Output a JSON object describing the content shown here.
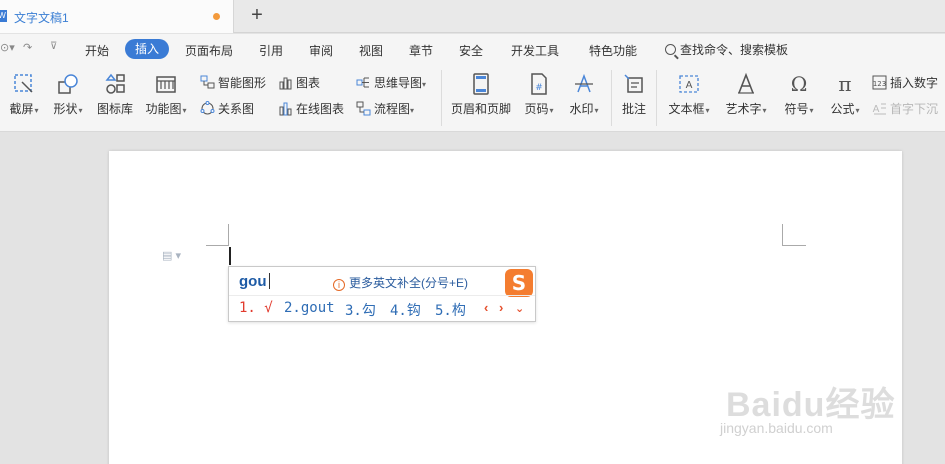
{
  "title_bar": {
    "tab_title": "文字文稿1",
    "new_tab": "+"
  },
  "menubar": {
    "items": [
      "开始",
      "插入",
      "页面布局",
      "引用",
      "审阅",
      "视图",
      "章节",
      "安全",
      "开发工具",
      "特色功能"
    ],
    "active": "插入",
    "search_label": "查找命令、搜索模板"
  },
  "ribbon": {
    "screenshot": "截屏",
    "shapes": "形状",
    "icon_library": "图标库",
    "function_chart": "功能图",
    "smart_art": "智能图形",
    "relation_chart": "关系图",
    "chart": "图表",
    "online_chart": "在线图表",
    "mind_map": "思维导图",
    "flowchart": "流程图",
    "header_footer": "页眉和页脚",
    "page_number": "页码",
    "watermark": "水印",
    "comment": "批注",
    "textbox": "文本框",
    "word_art": "艺术字",
    "symbol": "符号",
    "formula": "公式",
    "insert_number": "插入数字",
    "drop_cap": "首字下沉"
  },
  "ime": {
    "composition": "gou",
    "hint": "更多英文补全(分号+E)",
    "logo_letter": "S",
    "candidates": [
      "1. √",
      "2.gout",
      "3.勾",
      "4.钩",
      "5.构"
    ]
  },
  "watermark": {
    "main": "Baidu经验",
    "sub": "jingyan.baidu.com"
  },
  "colors": {
    "accent": "#3a7bd5",
    "ime_orange": "#f47d30",
    "candidate_first": "#e23b2e"
  }
}
